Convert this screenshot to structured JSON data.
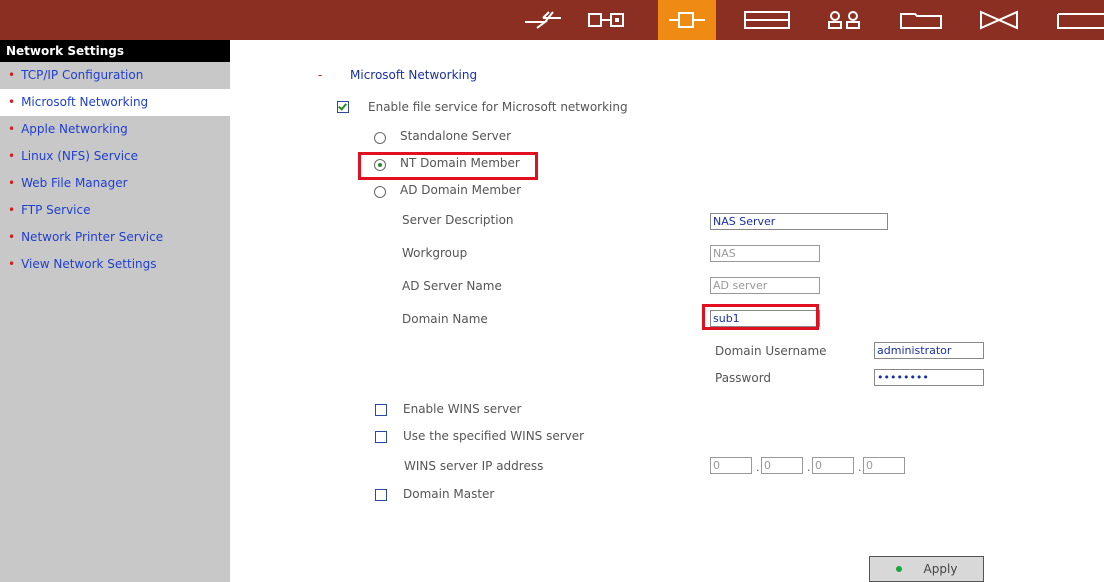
{
  "nav": {
    "icons": [
      "network-icon",
      "device-icon",
      "connection-icon",
      "storage-icon",
      "users-icon",
      "folder-icon",
      "mail-icon",
      "more-icon"
    ],
    "active_index": 2,
    "bar_color": "#8c2f23",
    "active_color": "#ef8a12"
  },
  "sidebar": {
    "title": "Network Settings",
    "items": [
      {
        "label": "TCP/IP Configuration"
      },
      {
        "label": "Microsoft Networking"
      },
      {
        "label": "Apple Networking"
      },
      {
        "label": "Linux (NFS) Service"
      },
      {
        "label": "Web File Manager"
      },
      {
        "label": "FTP Service"
      },
      {
        "label": "Network Printer Service"
      },
      {
        "label": "View Network Settings"
      }
    ],
    "active_index": 1,
    "bullet": "•"
  },
  "main": {
    "section_dash": "-",
    "section_title": "Microsoft Networking",
    "enable_label": "Enable file service for Microsoft networking",
    "enable_checked": true,
    "radios": {
      "standalone": "Standalone Server",
      "nt_domain": "NT Domain Member",
      "ad_domain": "AD Domain Member",
      "selected": "nt_domain"
    },
    "fields": {
      "server_description_label": "Server Description",
      "server_description_value": "NAS Server",
      "workgroup_label": "Workgroup",
      "workgroup_value": "NAS",
      "ad_server_label": "AD Server Name",
      "ad_server_value": "AD server",
      "domain_name_label": "Domain Name",
      "domain_name_value": "sub1",
      "domain_username_label": "Domain Username",
      "domain_username_value": "administrator",
      "password_label": "Password",
      "password_value": "••••••••"
    },
    "wins": {
      "enable_label": "Enable WINS server",
      "use_specified_label": "Use the specified WINS server",
      "ip_label": "WINS server IP address",
      "ip": [
        "0",
        "0",
        "0",
        "0"
      ],
      "domain_master_label": "Domain Master"
    },
    "apply_label": "Apply"
  }
}
